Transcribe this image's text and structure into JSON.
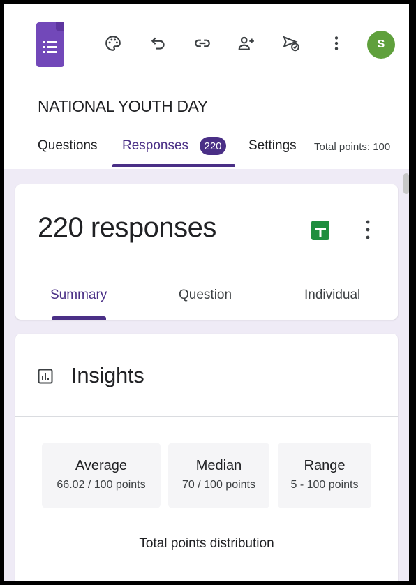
{
  "toolbar": {
    "icons": [
      "palette-icon",
      "undo-icon",
      "link-icon",
      "add-collaborator-icon",
      "send-icon",
      "more-vert-icon"
    ],
    "avatar_initial": "S"
  },
  "form": {
    "title": "NATIONAL YOUTH DAY"
  },
  "tabs": {
    "questions": "Questions",
    "responses": "Responses",
    "responses_badge": "220",
    "settings": "Settings",
    "total_points": "Total points: 100"
  },
  "responses_card": {
    "count_label": "220 responses",
    "sub_tabs": [
      "Summary",
      "Question",
      "Individual"
    ]
  },
  "insights": {
    "title": "Insights",
    "stats": [
      {
        "label": "Average",
        "value": "66.02 / 100 points"
      },
      {
        "label": "Median",
        "value": "70 / 100 points"
      },
      {
        "label": "Range",
        "value": "5 - 100 points"
      }
    ],
    "distribution_title": "Total points distribution"
  },
  "colors": {
    "brand_purple": "#4a2f86",
    "logo_purple": "#7248b9",
    "avatar_green": "#5fa03c",
    "sheets_green": "#1e8e3e"
  }
}
